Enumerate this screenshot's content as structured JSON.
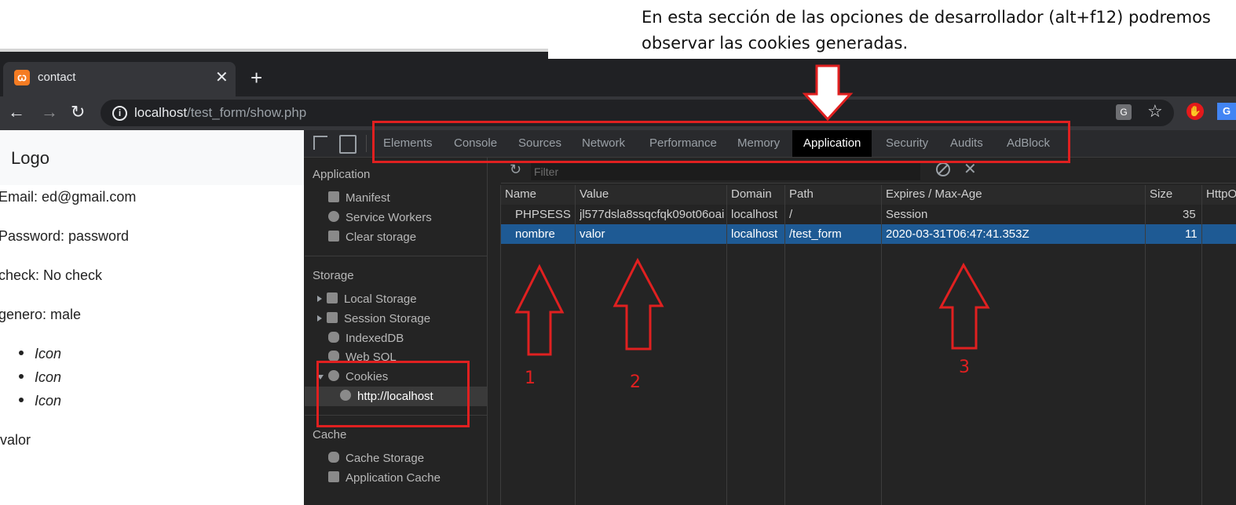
{
  "annotation": {
    "caption_line1": "En esta sección de las opciones de desarrollador (alt+f12) podremos",
    "caption_line2": "observar las cookies generadas.",
    "numbers": [
      "1",
      "2",
      "3"
    ],
    "color": "#e02020"
  },
  "browser": {
    "tab_title": "contact",
    "tab_close": "✕",
    "new_tab": "+",
    "url_host": "localhost",
    "url_path": "/test_form/show.php",
    "back": "←",
    "forward": "→",
    "reload": "↻",
    "star": "☆"
  },
  "page": {
    "logo": "Logo",
    "email": "Email: ed@gmail.com",
    "password": "Password: password",
    "check": "check: No check",
    "genero": "genero: male",
    "icons": [
      "Icon",
      "Icon",
      "Icon"
    ],
    "valor": "valor"
  },
  "devtools": {
    "tabs": [
      "Elements",
      "Console",
      "Sources",
      "Network",
      "Performance",
      "Memory",
      "Application",
      "Security",
      "Audits",
      "AdBlock"
    ],
    "active_tab": "Application",
    "sidebar": {
      "application_head": "Application",
      "application_items": [
        "Manifest",
        "Service Workers",
        "Clear storage"
      ],
      "storage_head": "Storage",
      "storage_items": [
        "Local Storage",
        "Session Storage",
        "IndexedDB",
        "Web SQL",
        "Cookies"
      ],
      "cookie_origin": "http://localhost",
      "cache_head": "Cache",
      "cache_items": [
        "Cache Storage",
        "Application Cache"
      ]
    },
    "filter_placeholder": "Filter",
    "columns": [
      "Name",
      "Value",
      "Domain",
      "Path",
      "Expires / Max-Age",
      "Size",
      "HttpO"
    ],
    "rows": [
      {
        "name": "PHPSESS...",
        "value": "jl577dsla8ssqcfqk09ot06oai",
        "domain": "localhost",
        "path": "/",
        "expires": "Session",
        "size": "35"
      },
      {
        "name": "nombre",
        "value": "valor",
        "domain": "localhost",
        "path": "/test_form",
        "expires": "2020-03-31T06:47:41.353Z",
        "size": "11"
      }
    ],
    "selected_row_color": "#1e5a94"
  }
}
